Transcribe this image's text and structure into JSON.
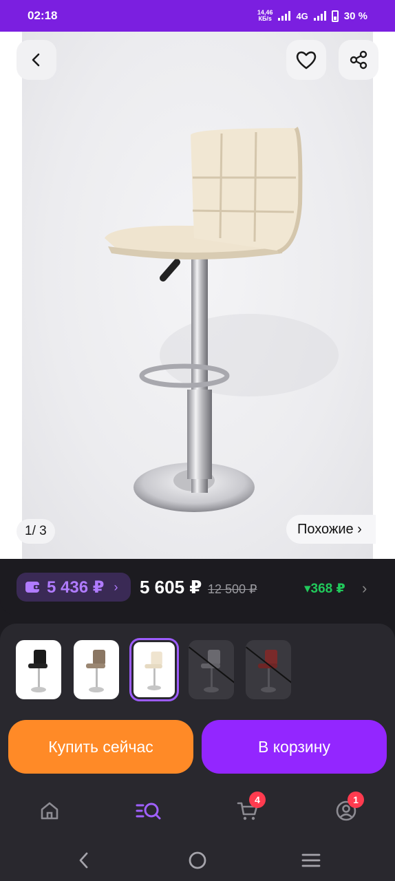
{
  "status_bar": {
    "time": "02:18",
    "net_speed_value": "14,46",
    "net_speed_unit": "КБ/s",
    "network": "4G",
    "battery": "30 %"
  },
  "product": {
    "image_counter": "1/ 3",
    "similar_label": "Похожие ›"
  },
  "prices": {
    "wallet_price": "5 436 ₽",
    "wallet_chevron": "›",
    "price": "5 605 ₽",
    "old_price": "12 500 ₽",
    "discount": "▾368 ₽",
    "discount_chevron": "›"
  },
  "variants": [
    {
      "color": "black",
      "selected": false,
      "available": true
    },
    {
      "color": "brown",
      "selected": false,
      "available": true
    },
    {
      "color": "cream",
      "selected": true,
      "available": true
    },
    {
      "color": "white",
      "selected": false,
      "available": false
    },
    {
      "color": "red",
      "selected": false,
      "available": false
    }
  ],
  "actions": {
    "buy_now": "Купить сейчас",
    "add_to_cart": "В корзину"
  },
  "bottom_nav": {
    "items": [
      {
        "icon": "home-icon",
        "active": false
      },
      {
        "icon": "catalog-search-icon",
        "active": true
      },
      {
        "icon": "cart-icon",
        "badge": "4"
      },
      {
        "icon": "profile-icon",
        "badge": "1"
      }
    ]
  },
  "colors": {
    "brand_purple": "#7b1fe0",
    "buy_orange": "#ff8a27",
    "cart_purple": "#9326ff",
    "discount_green": "#21c95b",
    "badge_red": "#ff3b4f"
  }
}
